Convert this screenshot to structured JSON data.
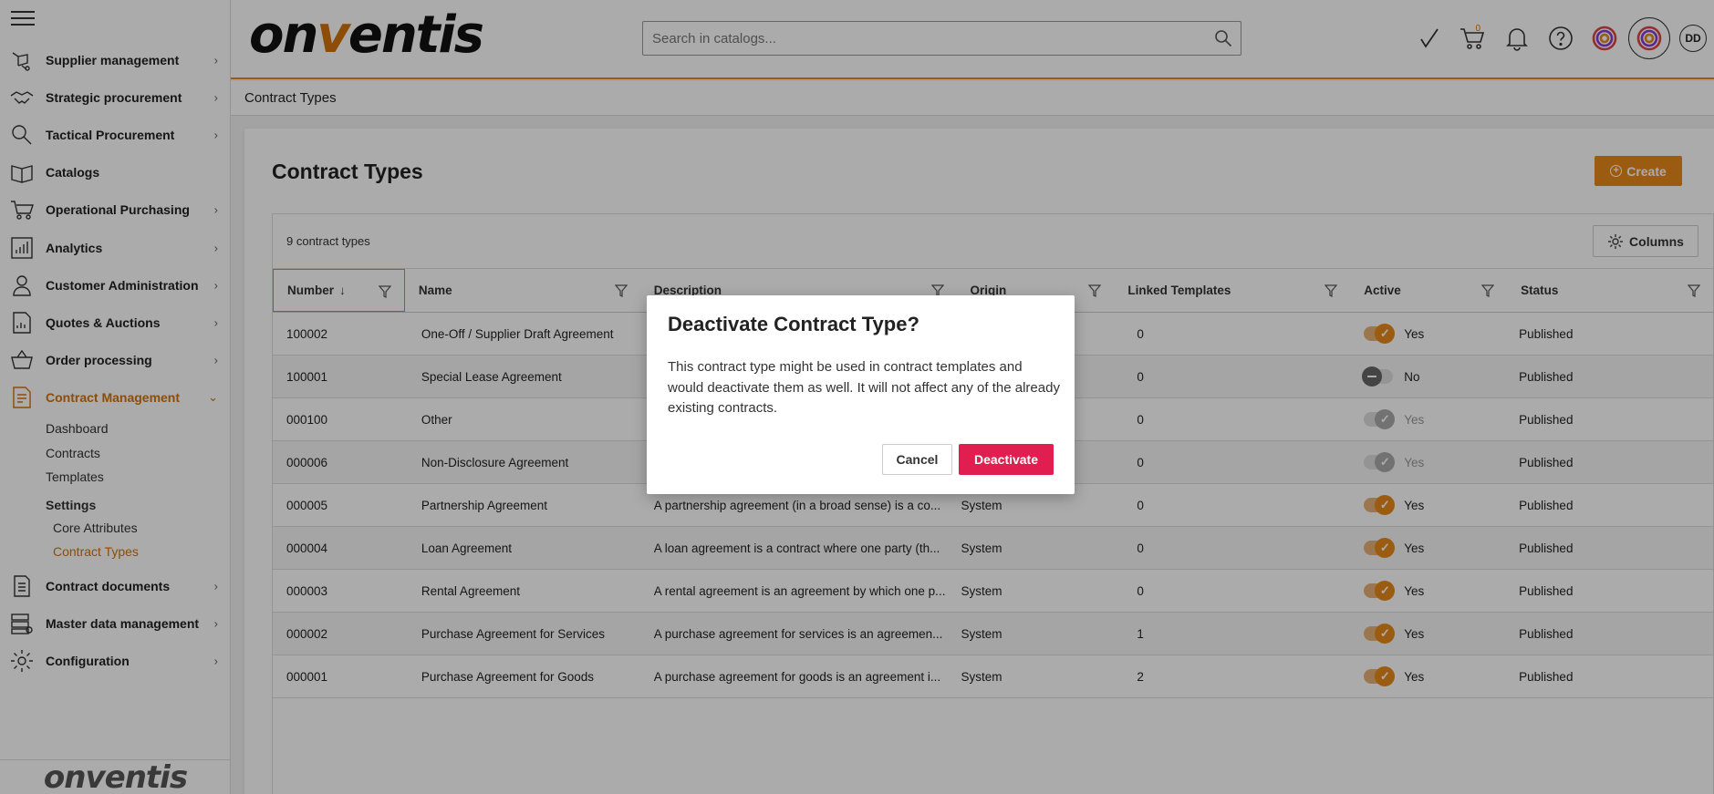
{
  "sidebar": {
    "items": [
      {
        "label": "Supplier management",
        "icon": "supplier-icon",
        "chevron": "›"
      },
      {
        "label": "Strategic procurement",
        "icon": "handshake-icon",
        "chevron": "›"
      },
      {
        "label": "Tactical Procurement",
        "icon": "magnifier-icon",
        "chevron": "›"
      },
      {
        "label": "Catalogs",
        "icon": "book-icon",
        "chevron": ""
      },
      {
        "label": "Operational Purchasing",
        "icon": "cart-icon",
        "chevron": "›"
      },
      {
        "label": "Analytics",
        "icon": "bar-chart-icon",
        "chevron": "›"
      },
      {
        "label": "Customer Administration",
        "icon": "user-icon",
        "chevron": "›"
      },
      {
        "label": "Quotes & Auctions",
        "icon": "document-chart-icon",
        "chevron": "›"
      },
      {
        "label": "Order processing",
        "icon": "basket-icon",
        "chevron": "›"
      },
      {
        "label": "Contract Management",
        "icon": "contract-icon",
        "chevron": "⌄"
      }
    ],
    "contract_sub": {
      "items": [
        "Dashboard",
        "Contracts",
        "Templates"
      ],
      "settings_label": "Settings",
      "settings_items": [
        "Core Attributes",
        "Contract Types"
      ]
    },
    "bottom_items": [
      {
        "label": "Contract documents",
        "icon": "documents-icon",
        "chevron": "›"
      },
      {
        "label": "Master data management",
        "icon": "database-icon",
        "chevron": "›"
      },
      {
        "label": "Configuration",
        "icon": "gear-icon",
        "chevron": "›"
      }
    ],
    "logo": "onventis"
  },
  "topbar": {
    "logo_a": "on",
    "logo_v": "v",
    "logo_b": "entis",
    "search_placeholder": "Search in catalogs...",
    "cart_count": "0",
    "avatar": "DD"
  },
  "breadcrumb": "Contract Types",
  "page": {
    "title": "Contract Types",
    "create_label": "Create",
    "count_label": "9 contract types",
    "columns_label": "Columns"
  },
  "table": {
    "headers": [
      "Number",
      "Name",
      "Description",
      "Origin",
      "Linked Templates",
      "Active",
      "Status"
    ],
    "sort_arrow": "↓",
    "rows": [
      {
        "number": "100002",
        "name": "One-Off / Supplier Draft Agreement",
        "description": "",
        "origin": "",
        "linked": "0",
        "active": "Yes",
        "state": "on",
        "status": "Published"
      },
      {
        "number": "100001",
        "name": "Special Lease Agreement",
        "description": "",
        "origin": "",
        "linked": "0",
        "active": "No",
        "state": "off",
        "status": "Published"
      },
      {
        "number": "000100",
        "name": "Other",
        "description": "",
        "origin": "",
        "linked": "0",
        "active": "Yes",
        "state": "dis",
        "status": "Published"
      },
      {
        "number": "000006",
        "name": "Non-Disclosure Agreement",
        "description": "",
        "origin": "",
        "linked": "0",
        "active": "Yes",
        "state": "dis",
        "status": "Published"
      },
      {
        "number": "000005",
        "name": "Partnership Agreement",
        "description": "A partnership agreement (in a broad sense) is a co...",
        "origin": "System",
        "linked": "0",
        "active": "Yes",
        "state": "on",
        "status": "Published"
      },
      {
        "number": "000004",
        "name": "Loan Agreement",
        "description": "A loan agreement is a contract where one party (th...",
        "origin": "System",
        "linked": "0",
        "active": "Yes",
        "state": "on",
        "status": "Published"
      },
      {
        "number": "000003",
        "name": "Rental Agreement",
        "description": "A rental agreement is an agreement by which one p...",
        "origin": "System",
        "linked": "0",
        "active": "Yes",
        "state": "on",
        "status": "Published"
      },
      {
        "number": "000002",
        "name": "Purchase Agreement for Services",
        "description": "A purchase agreement for services is an agreemen...",
        "origin": "System",
        "linked": "1",
        "active": "Yes",
        "state": "on",
        "status": "Published"
      },
      {
        "number": "000001",
        "name": "Purchase Agreement for Goods",
        "description": "A purchase agreement for goods is an agreement i...",
        "origin": "System",
        "linked": "2",
        "active": "Yes",
        "state": "on",
        "status": "Published"
      }
    ]
  },
  "modal": {
    "title": "Deactivate Contract Type?",
    "body": "This contract type might be used in contract templates and would deactivate them as well. It will not affect any of the already existing contracts.",
    "cancel_label": "Cancel",
    "confirm_label": "Deactivate"
  },
  "colors": {
    "accent": "#e8891c",
    "danger": "#e01e4f"
  }
}
